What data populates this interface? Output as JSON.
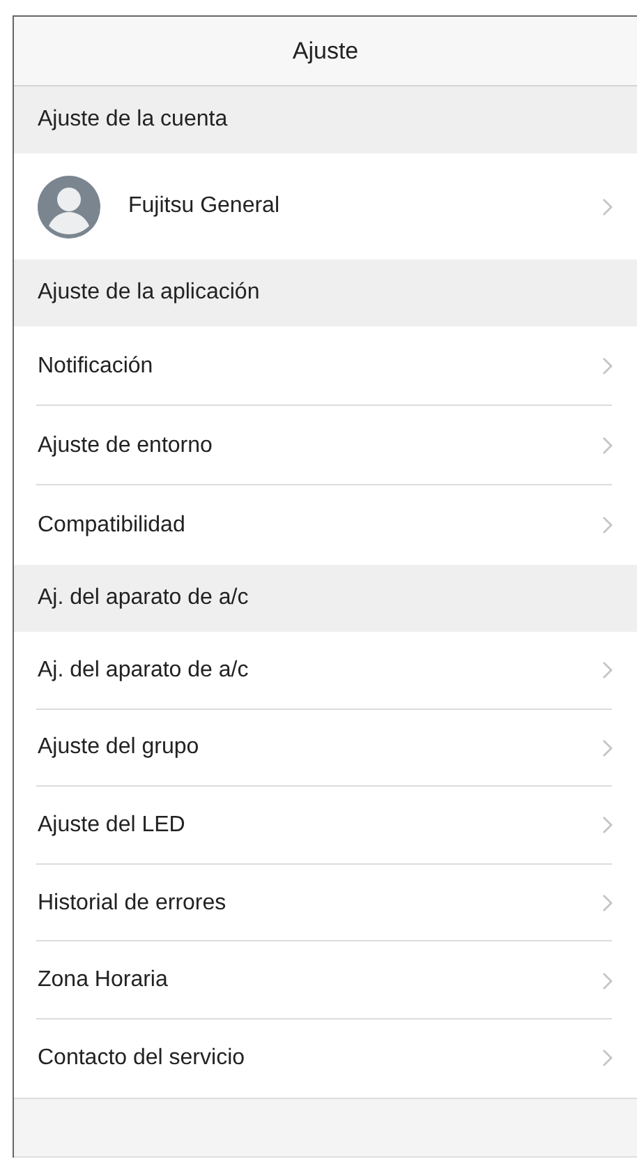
{
  "header": {
    "title": "Ajuste"
  },
  "sections": [
    {
      "title": "Ajuste de la cuenta",
      "items": [
        {
          "kind": "account",
          "label": "Fujitsu General"
        }
      ]
    },
    {
      "title": "Ajuste de la aplicación",
      "items": [
        {
          "kind": "plain",
          "label": "Notificación"
        },
        {
          "kind": "plain",
          "label": "Ajuste de entorno"
        },
        {
          "kind": "plain",
          "label": "Compatibilidad"
        }
      ]
    },
    {
      "title": "Aj. del aparato de a/c",
      "items": [
        {
          "kind": "plain",
          "label": "Aj. del aparato de a/c"
        },
        {
          "kind": "plain",
          "label": "Ajuste del grupo"
        },
        {
          "kind": "plain",
          "label": "Ajuste del LED"
        },
        {
          "kind": "plain",
          "label": "Historial de errores"
        },
        {
          "kind": "plain",
          "label": "Zona Horaria"
        },
        {
          "kind": "plain",
          "label": "Contacto del servicio"
        }
      ]
    }
  ]
}
